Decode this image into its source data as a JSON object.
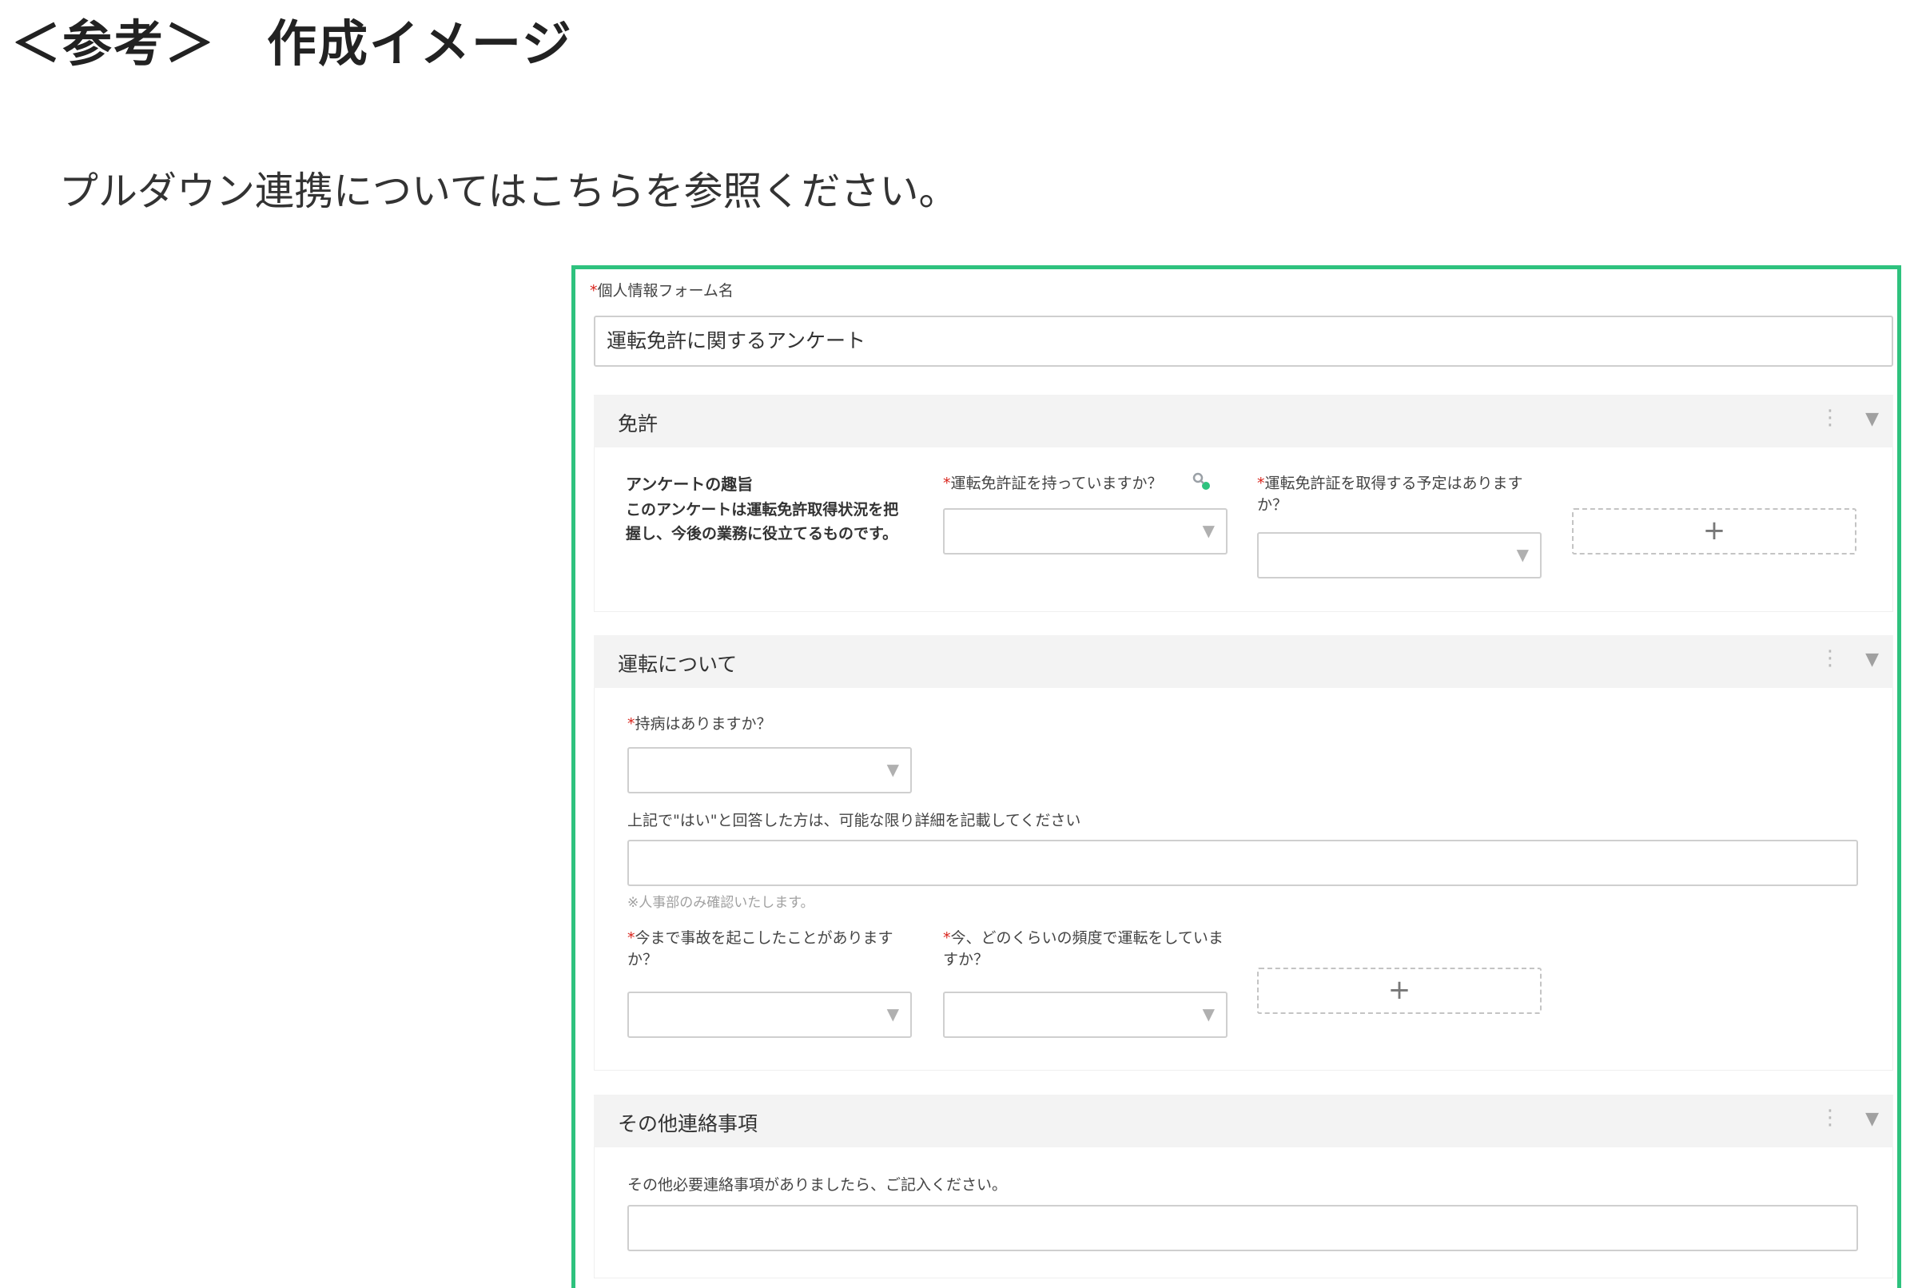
{
  "page": {
    "heading": "＜参考＞　作成イメージ",
    "intro": "プルダウン連携についてはこちらを参照ください。"
  },
  "form": {
    "name_label": "個人情報フォーム名",
    "required_mark": "*",
    "name_value": "運転免許に関するアンケート"
  },
  "sections": [
    {
      "title": "免許",
      "menu_icon": "⋮",
      "toggle_icon": "▼",
      "description_title": "アンケートの趣旨",
      "description_text": "このアンケートは運転免許取得状況を把握し、今後の業務に役立てるものです。",
      "q1_label": "運転免許証を持っていますか？",
      "q2_label": "運転免許証を取得する予定はありますか？",
      "add_label": "+"
    },
    {
      "title": "運転について",
      "menu_icon": "⋮",
      "toggle_icon": "▼",
      "q1_label": "持病はありますか？",
      "detail_label": "上記で\"はい\"と回答した方は、可能な限り詳細を記載してください",
      "detail_note": "※人事部のみ確認いたします。",
      "q2_label": "今まで事故を起こしたことがありますか？",
      "q3_label": "今、どのくらいの頻度で運転をしていますか？",
      "add_label": "+"
    },
    {
      "title": "その他連絡事項",
      "menu_icon": "⋮",
      "toggle_icon": "▼",
      "q1_label": "その他必要連絡事項がありましたら、ご記入ください。"
    }
  ],
  "icons": {
    "dropdown_arrow": "▼",
    "link_icon": "link-key-icon"
  },
  "colors": {
    "frame_border": "#2ec27e",
    "required": "#d9241c",
    "link_icon": "#2ec27e"
  }
}
